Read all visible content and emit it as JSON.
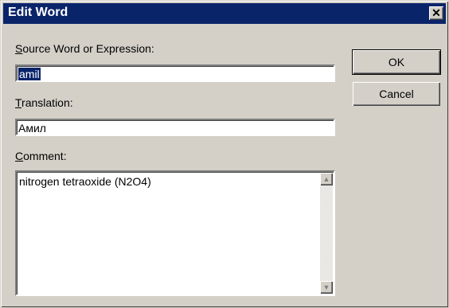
{
  "window": {
    "title": "Edit Word",
    "close_glyph": "✕"
  },
  "fields": {
    "source_label_accel": "S",
    "source_label_rest": "ource Word or Expression:",
    "source_value": "amil",
    "translation_label_accel": "T",
    "translation_label_rest": "ranslation:",
    "translation_value": "Амил",
    "comment_label_accel": "C",
    "comment_label_rest": "omment:",
    "comment_value": "nitrogen tetraoxide (N2O4)"
  },
  "buttons": {
    "ok": "OK",
    "cancel": "Cancel"
  }
}
